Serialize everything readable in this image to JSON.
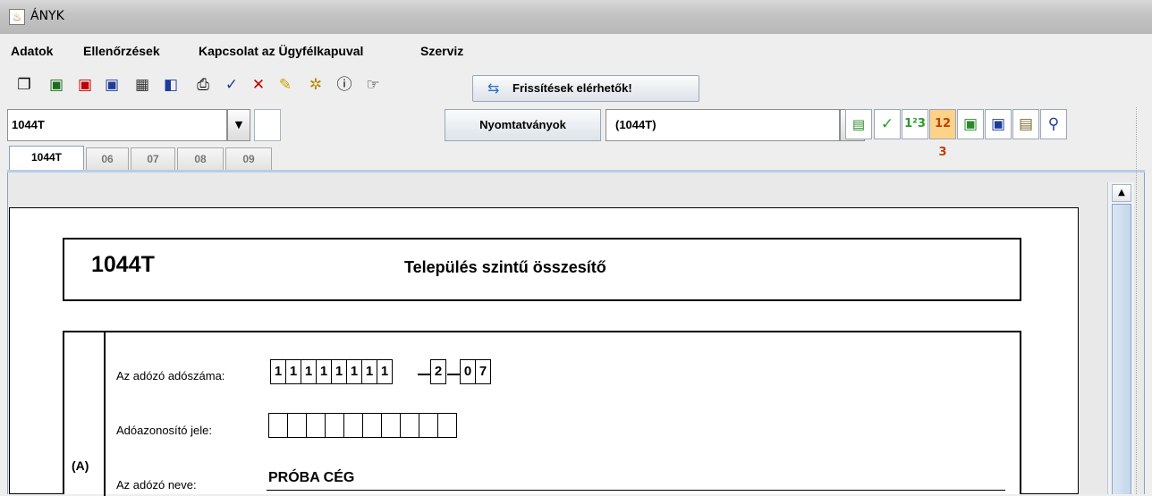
{
  "window": {
    "title": "ÁNYK"
  },
  "menu": [
    "Adatok",
    "Ellenőrzések",
    "Kapcsolat az Ügyfélkapuval",
    "Szerviz"
  ],
  "toolbar": {
    "icons": [
      "copy-icon",
      "new-form-icon",
      "close-form-icon",
      "save-form-icon",
      "check-icon",
      "gear-icon",
      "print-icon",
      "checkmark-icon",
      "delete-icon",
      "pencil-icon",
      "plugins-icon",
      "info-icon",
      "pointer-icon"
    ],
    "update_label": "Frissítések elérhetők!"
  },
  "form_selector": {
    "value": "1044T"
  },
  "nyomtatvanyok_label": "Nyomtatványok",
  "form_combo": {
    "value": "(1044T)"
  },
  "tabs": [
    "1044T",
    "06",
    "07",
    "08",
    "09"
  ],
  "page": {
    "code": "1044T",
    "title": "Település szintű összesítő",
    "section_label": "(A)",
    "fields": {
      "tax_number_label": "Az adózó adószáma:",
      "tax_number_main": [
        "1",
        "1",
        "1",
        "1",
        "1",
        "1",
        "1",
        "1"
      ],
      "tax_number_mid": [
        "2"
      ],
      "tax_number_end": [
        "0",
        "7"
      ],
      "tax_id_label": "Adóazonosító jele:",
      "tax_id_cells": [
        "",
        "",
        "",
        "",
        "",
        "",
        "",
        "",
        "",
        ""
      ],
      "name_label": "Az adózó neve:",
      "name_value": "PRÓBA CÉG"
    }
  }
}
